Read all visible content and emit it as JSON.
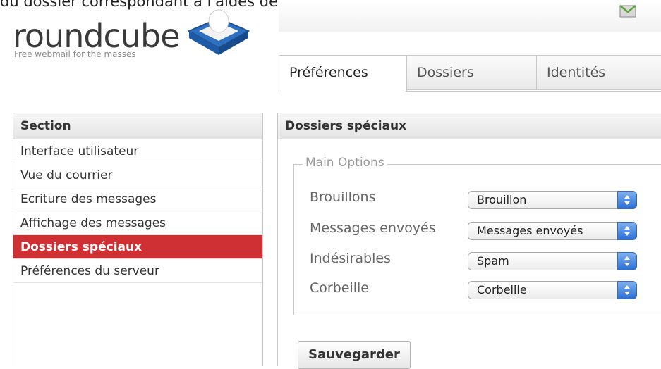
{
  "caption": "du dossier correspondant à l'aides des listes déroulantes.",
  "logo": {
    "wordmark": "roundcube",
    "tagline": "Free webmail for the masses"
  },
  "icons": {
    "top_right": "mail-icon",
    "logo_box": "roundcube-box-icon",
    "select_arrows": "up-down-arrows-icon"
  },
  "tabs": [
    {
      "label": "Préférences",
      "active": true
    },
    {
      "label": "Dossiers",
      "active": false
    },
    {
      "label": "Identités",
      "active": false
    }
  ],
  "section_panel": {
    "header": "Section",
    "items": [
      {
        "label": "Interface utilisateur",
        "selected": false
      },
      {
        "label": "Vue du courrier",
        "selected": false
      },
      {
        "label": "Ecriture des messages",
        "selected": false
      },
      {
        "label": "Affichage des messages",
        "selected": false
      },
      {
        "label": "Dossiers spéciaux",
        "selected": true
      },
      {
        "label": "Préférences du serveur",
        "selected": false
      }
    ]
  },
  "content_panel": {
    "header": "Dossiers spéciaux",
    "fieldset_legend": "Main Options",
    "rows": [
      {
        "label": "Brouillons",
        "value": "Brouillon"
      },
      {
        "label": "Messages envoyés",
        "value": "Messages envoyés"
      },
      {
        "label": "Indésirables",
        "value": "Spam"
      },
      {
        "label": "Corbeille",
        "value": "Corbeille"
      }
    ],
    "save_label": "Sauvegarder"
  },
  "colors": {
    "selected_bg": "#cf3034",
    "select_stepper": "#2d6fd4"
  }
}
